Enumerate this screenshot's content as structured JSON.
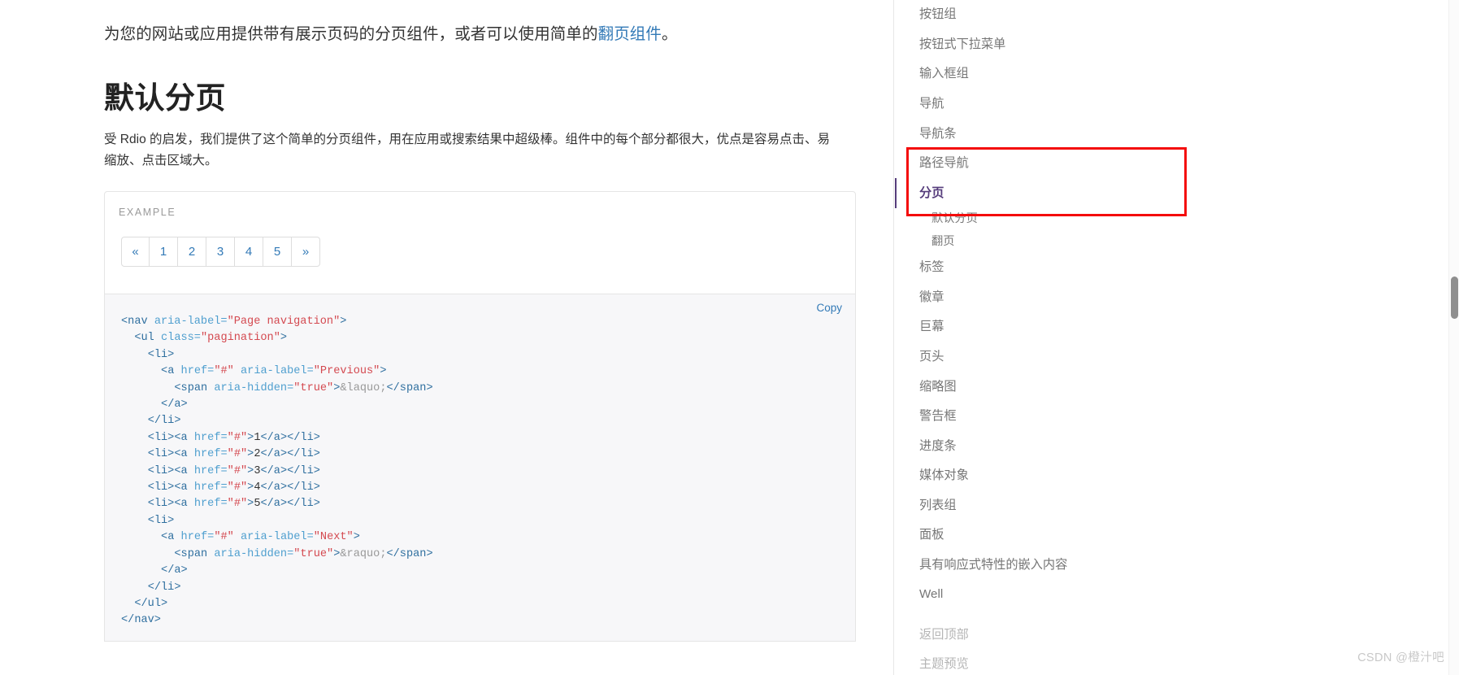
{
  "content": {
    "lead": {
      "before_link": "为您的网站或应用提供带有展示页码的分页组件，或者可以使用简单的",
      "link_text": "翻页组件",
      "after_link": "。"
    },
    "heading": "默认分页",
    "paragraph": "受 Rdio 的启发，我们提供了这个简单的分页组件，用在应用或搜索结果中超级棒。组件中的每个部分都很大，优点是容易点击、易缩放、点击区域大。",
    "example": {
      "label": "EXAMPLE",
      "pagination": [
        "«",
        "1",
        "2",
        "3",
        "4",
        "5",
        "»"
      ]
    },
    "code": {
      "copy_label": "Copy",
      "lines": [
        "<nav aria-label=\"Page navigation\">",
        "  <ul class=\"pagination\">",
        "    <li>",
        "      <a href=\"#\" aria-label=\"Previous\">",
        "        <span aria-hidden=\"true\">&laquo;</span>",
        "      </a>",
        "    </li>",
        "    <li><a href=\"#\">1</a></li>",
        "    <li><a href=\"#\">2</a></li>",
        "    <li><a href=\"#\">3</a></li>",
        "    <li><a href=\"#\">4</a></li>",
        "    <li><a href=\"#\">5</a></li>",
        "    <li>",
        "      <a href=\"#\" aria-label=\"Next\">",
        "        <span aria-hidden=\"true\">&raquo;</span>",
        "      </a>",
        "    </li>",
        "  </ul>",
        "</nav>"
      ]
    }
  },
  "sidebar": {
    "items": [
      {
        "label": "按钮组",
        "state": "normal"
      },
      {
        "label": "按钮式下拉菜单",
        "state": "normal"
      },
      {
        "label": "输入框组",
        "state": "normal"
      },
      {
        "label": "导航",
        "state": "normal"
      },
      {
        "label": "导航条",
        "state": "normal"
      },
      {
        "label": "路径导航",
        "state": "normal"
      },
      {
        "label": "分页",
        "state": "active"
      },
      {
        "label": "默认分页",
        "state": "sub"
      },
      {
        "label": "翻页",
        "state": "sub"
      },
      {
        "label": "标签",
        "state": "normal"
      },
      {
        "label": "徽章",
        "state": "normal"
      },
      {
        "label": "巨幕",
        "state": "normal"
      },
      {
        "label": "页头",
        "state": "normal"
      },
      {
        "label": "缩略图",
        "state": "normal"
      },
      {
        "label": "警告框",
        "state": "normal"
      },
      {
        "label": "进度条",
        "state": "normal"
      },
      {
        "label": "媒体对象",
        "state": "normal"
      },
      {
        "label": "列表组",
        "state": "normal"
      },
      {
        "label": "面板",
        "state": "normal"
      },
      {
        "label": "具有响应式特性的嵌入内容",
        "state": "normal"
      },
      {
        "label": "Well",
        "state": "normal"
      },
      {
        "label": "返回顶部",
        "state": "faded"
      },
      {
        "label": "主题预览",
        "state": "faded"
      }
    ]
  },
  "watermark": "CSDN @橙汁吧",
  "colors": {
    "link": "#337ab7",
    "active_nav": "#563d7c",
    "annotation": "#f40c0c",
    "code_tag": "#2f6f9f",
    "code_attr": "#4f9fcf",
    "code_value": "#d44950"
  }
}
